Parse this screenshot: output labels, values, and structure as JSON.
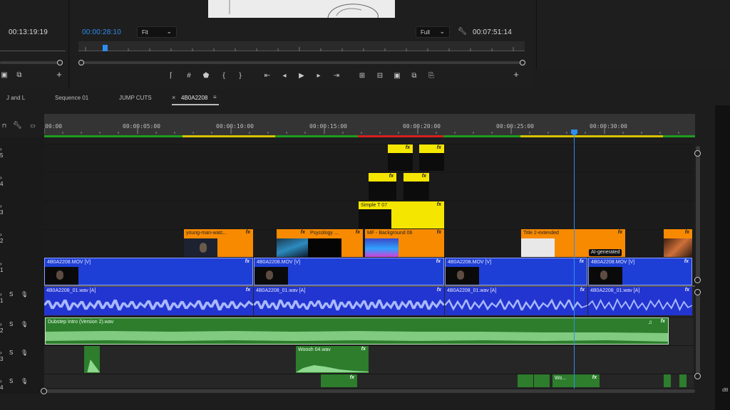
{
  "program": {
    "source_timecode": "00:13:19:19",
    "playhead_timecode": "00:00:28:10",
    "zoom": "Fit",
    "resolution": "Full",
    "duration_timecode": "00:07:51:14"
  },
  "tabs": [
    {
      "label": "J and L"
    },
    {
      "label": "Sequence 01"
    },
    {
      "label": "JUMP CUTS"
    },
    {
      "label": "4B0A2208",
      "close": "×",
      "menu": "≡",
      "active": true
    }
  ],
  "ruler": [
    "00:00",
    "00:00:05:00",
    "00:00:10:00",
    "00:00:15:00",
    "00:00:20:00",
    "00:00:25:00",
    "00:00:30:00"
  ],
  "track_labels": {
    "solo": "S",
    "numbers": [
      "5",
      "4",
      "3",
      "2",
      "1",
      "1",
      "2",
      "3",
      "4"
    ]
  },
  "clips": {
    "v5": [
      {
        "fx": "fx"
      },
      {
        "fx": "fx"
      }
    ],
    "v4": [
      {
        "fx": "fx"
      },
      {
        "fx": "fx"
      }
    ],
    "v3": [
      {
        "name": "Simple T 07",
        "fx": "fx"
      }
    ],
    "v2": [
      {
        "name": "young-man-watc...",
        "fx": "fx"
      },
      {
        "name": "",
        "fx": "fx"
      },
      {
        "name": "Psycology ...",
        "fx": "fx"
      },
      {
        "name": "MF - Background 06",
        "fx": "fx"
      },
      {
        "name": "Title 2-extended",
        "fx": "fx"
      },
      {
        "name": "",
        "fx": "fx"
      }
    ],
    "v1": [
      {
        "name": "4B0A2208.MOV [V]",
        "fx": "fx"
      },
      {
        "name": "4B0A2208.MOV [V]",
        "fx": "fx"
      },
      {
        "name": "4B0A2208.MOV [V]",
        "fx": "fx"
      },
      {
        "name": "4B0A2208.MOV [V]",
        "fx": "fx"
      }
    ],
    "a1": [
      {
        "name": "4B0A2208_01.wav [A]",
        "fx": "fx"
      },
      {
        "name": "4B0A2208_01.wav [A]",
        "fx": "fx"
      },
      {
        "name": "4B0A2208_01.wav [A]",
        "fx": "fx"
      },
      {
        "name": "4B0A2208_01.wav [A]",
        "fx": "fx"
      }
    ],
    "a2": [
      {
        "name": "Dubstep Intro (Version 2).wav",
        "fx": "fx",
        "note": "♫"
      }
    ],
    "a3": [
      {
        "name": "Woosh 04.wav",
        "fx": "fx"
      }
    ],
    "a4": [
      {
        "name": "Wo...",
        "fx": "fx"
      },
      {
        "fx": "fx"
      }
    ]
  },
  "badge": "AI-generated",
  "colors": {
    "accent": "#2e8ef0",
    "video_blue": "#1e3fd6",
    "audio_blue": "#2235d0",
    "title_yellow": "#f5e600",
    "graphic_orange": "#f88a00",
    "audio_green": "#2d7d2d"
  },
  "icons": {
    "wrench": "wrench-icon",
    "add": "plus-icon",
    "marker": "marker-icon",
    "camera": "camera-icon",
    "mic": "microphone-icon"
  }
}
